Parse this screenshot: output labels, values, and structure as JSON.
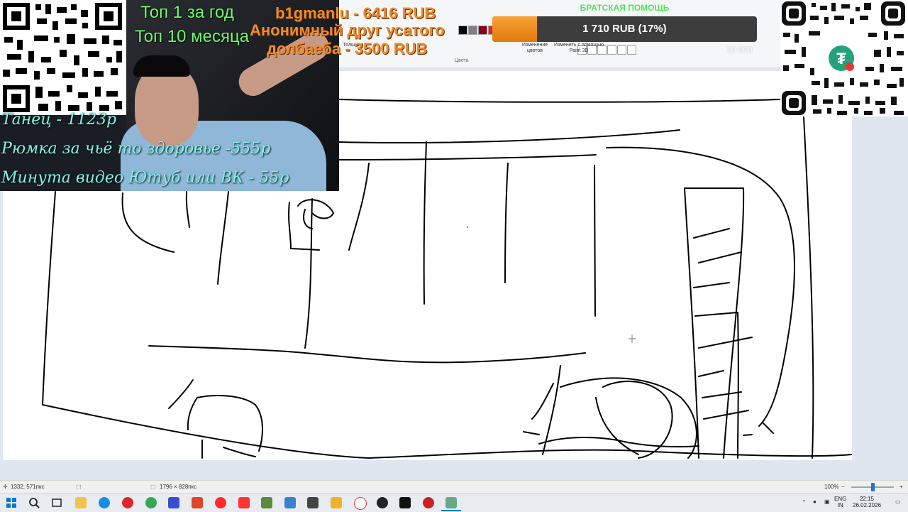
{
  "stream": {
    "top_year": "Топ 1 за год",
    "top_month": "Топ 10 месяца",
    "donations": [
      "b1gmanlu - 6416 RUB",
      "Анонимный друг усатого",
      "долбаеба - 3500 RUB"
    ],
    "menu": [
      "Танец - 1123р",
      "Рюмка за чьё то здоровье -555р",
      "Минута видео Ютуб или ВК - 55р"
    ],
    "goal": {
      "title": "БРАТСКАЯ ПОМОЩЬ",
      "progress_text": "1 710 RUB (17%)",
      "progress_fraction": 0.17,
      "max_text": "10 000"
    }
  },
  "paint": {
    "ribbon": {
      "thickness_label": "Толщина",
      "edit_colors_label": "Изменение цветов",
      "paint3d_label": "Изменить с помощью Paint 3D",
      "colors_group": "Цвета"
    },
    "status": {
      "cursor_pos": "1332, 571пкс",
      "canvas_size": "1796 × 828пкс",
      "zoom": "100%"
    }
  },
  "taskbar": {
    "lang_top": "ENG",
    "lang_bottom": "IN",
    "time": "22:15",
    "date": "26.02.2026"
  },
  "colors": {
    "goal_fill": "#f08a1c",
    "green_text": "#6cff6c",
    "orange_text": "#f08a28",
    "cyan_text": "#7ff5e8"
  }
}
